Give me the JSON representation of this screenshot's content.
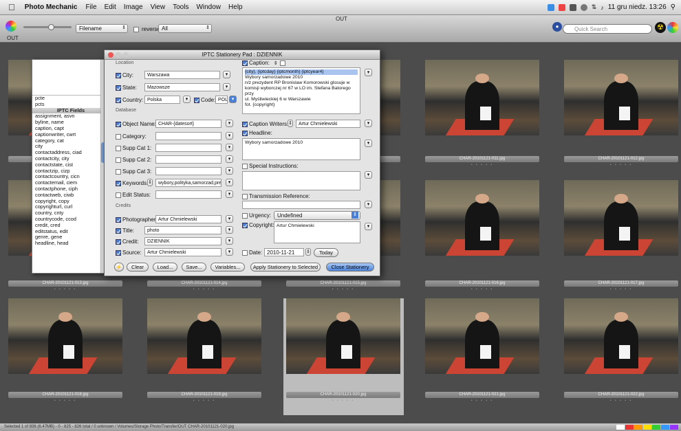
{
  "menubar": {
    "app": "Photo Mechanic",
    "items": [
      "File",
      "Edit",
      "Image",
      "View",
      "Tools",
      "Window",
      "Help"
    ],
    "clock": "11 gru niedz. 13:26"
  },
  "toolbar": {
    "folder": "OUT",
    "sort": "Filename",
    "reverse": "reverse",
    "filter": "All",
    "search_placeholder": "Quick Search",
    "tab": "OUT"
  },
  "thumbnails": [
    {
      "name": ""
    },
    {
      "name": ""
    },
    {
      "name": ""
    },
    {
      "name": "CHAR-20101121-011.jpg"
    },
    {
      "name": "CHAR-20101121-012.jpg"
    },
    {
      "name": "CHAR-20101121-013.jpg"
    },
    {
      "name": "CHAR-20101121-014.jpg"
    },
    {
      "name": "CHAR-20101121-015.jpg"
    },
    {
      "name": "CHAR-20101121-016.jpg"
    },
    {
      "name": "CHAR-20101121-017.jpg"
    },
    {
      "name": "CHAR-20101121-018.jpg"
    },
    {
      "name": "CHAR-20101121-019.jpg"
    },
    {
      "name": "CHAR-20101121-020.jpg"
    },
    {
      "name": "CHAR-20101121-021.jpg"
    },
    {
      "name": "CHAR-20101121-022.jpg"
    }
  ],
  "status": "Selected 1 of 836 (6.47MB) - 0 - 825 - 826 total / 0 unknown / Volumes/Storage Photo/Transfer/OUT CHAR-20101121-020.jpg",
  "fieldlist": {
    "items_before": [
      "pcte",
      "pcts"
    ],
    "header": "IPTC Fields",
    "items": [
      "assignment, asvn",
      "byline, name",
      "caption, capt",
      "captionwriter, cwrt",
      "category, cat",
      "city",
      "contactaddress, ciad",
      "contactcity, city",
      "contactstate, cist",
      "contactzip, cizp",
      "contactcountry, cicn",
      "contactemail, ciem",
      "contactphone, ciph",
      "contactweb, ciwb",
      "copyright, copy",
      "copyrighturl, curl",
      "country, cnty",
      "countrycode, ccod",
      "credit, cred",
      "editstatus, edit",
      "genre, gene",
      "headline, head"
    ]
  },
  "pad": {
    "title": "IPTC Stationery Pad : DZIENNIK",
    "location_label": "Location",
    "city_label": "City:",
    "city": "Warszawa",
    "state_label": "State:",
    "state": "Mazowsze",
    "country_label": "Country:",
    "country": "Polska",
    "code_label": "Code:",
    "code": "POL",
    "database_label": "Database",
    "object_label": "Object Name:",
    "object": "CHAR-{datesort}",
    "category_label": "Category:",
    "supp1": "Supp Cat 1:",
    "supp2": "Supp Cat 2:",
    "supp3": "Supp Cat 3:",
    "keywords_label": "Keywords:",
    "keywords": "wybory,polityka,samorzad,pre",
    "edit_status_label": "Edit Status:",
    "credits_label": "Credits",
    "photographer_label": "Photographer:",
    "photographer": "Artur Chmielewski",
    "title_label": "Title:",
    "title_val": "photo",
    "credit_label": "Credit:",
    "credit": "DZIENNIK",
    "source_label": "Source:",
    "source": "Artur Chmielewski",
    "caption_label": "Caption:",
    "caption_lines": [
      "{city}, {iptcday} {iptcmonth} {iptcyear4}",
      "Wybory samorzadowe 2010",
      "n/z prezydent RP Bronislaw Komorowski glosuje w",
      "komisji wyborczej nr 67 w LO im. Stefana Batorego przy",
      "ul. Myśliwieckiej 6 w Warszawie",
      "fot. {copyright}"
    ],
    "caption_writers_label": "Caption Writers:",
    "caption_writers": "Artur Chmielewski",
    "headline_label": "Headline:",
    "headline": "Wybory samorzadowe 2010",
    "special_label": "Special Instructions:",
    "transmission_label": "Transmission Reference:",
    "urgency_label": "Urgency:",
    "urgency": "Undefined",
    "copyright_label": "Copyright:",
    "copyright": "Artur Chmielewski",
    "date_label": "Date:",
    "date": "2010-11-21",
    "today": "Today",
    "buttons": {
      "clear": "Clear",
      "load": "Load...",
      "save": "Save...",
      "variables": "Variables...",
      "apply": "Apply Stationery to Selected",
      "close": "Close Stationery"
    }
  }
}
